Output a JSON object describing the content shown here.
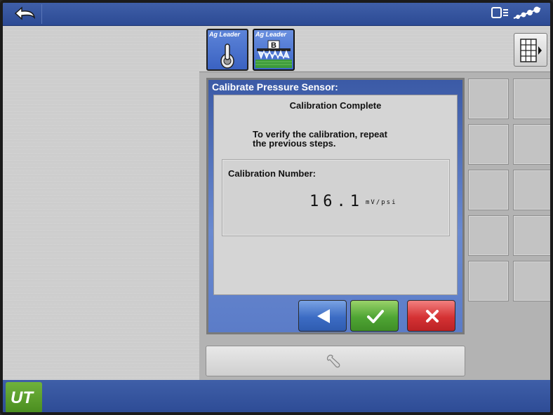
{
  "tabs": [
    {
      "brand": "Ag Leader"
    },
    {
      "brand": "Ag Leader",
      "badge": "B"
    }
  ],
  "dialog": {
    "title": "Calibrate Pressure Sensor:",
    "heading": "Calibration Complete",
    "message_line1": "To verify the calibration, repeat",
    "message_line2": "the previous steps.",
    "cal_label": "Calibration Number:",
    "cal_value": "16.1",
    "cal_unit": "mV/psi"
  },
  "bottombar": {
    "logo_text": "UT"
  },
  "colors": {
    "bar_blue": "#2c4a94",
    "ok_green": "#4fa534",
    "cancel_red": "#d53234",
    "back_blue": "#3c6cc4"
  },
  "icons": {
    "back": "undo-arrow-icon",
    "status_display": "display-icon",
    "status_signal": "signal-strength-icon",
    "grid": "grid-layout-icon",
    "tool": "wrench-icon"
  }
}
